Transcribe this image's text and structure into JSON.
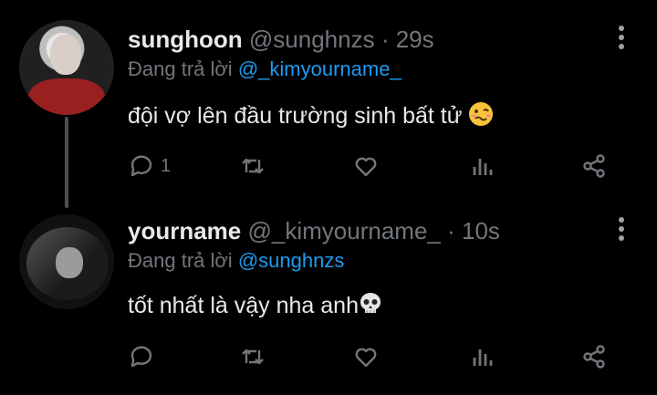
{
  "colors": {
    "background": "#000000",
    "text": "#e7e9ea",
    "muted": "#71767b",
    "accent": "#1d9bf0"
  },
  "tweets": [
    {
      "display_name": "sunghoon",
      "handle": "@sunghnzs",
      "separator": "·",
      "time": "29s",
      "reply_prefix": "Đang trả lời",
      "reply_to": "@_kimyourname_",
      "text": "đội vợ lên đầu trường sinh bất tử",
      "emoji": "woozy-face-icon",
      "reply_count": "1"
    },
    {
      "display_name": "yourname",
      "handle": "@_kimyourname_",
      "separator": "·",
      "time": "10s",
      "reply_prefix": "Đang trả lời",
      "reply_to": "@sunghnzs",
      "text": "tốt nhất là vậy nha anh",
      "emoji": "skull-icon",
      "reply_count": ""
    }
  ]
}
